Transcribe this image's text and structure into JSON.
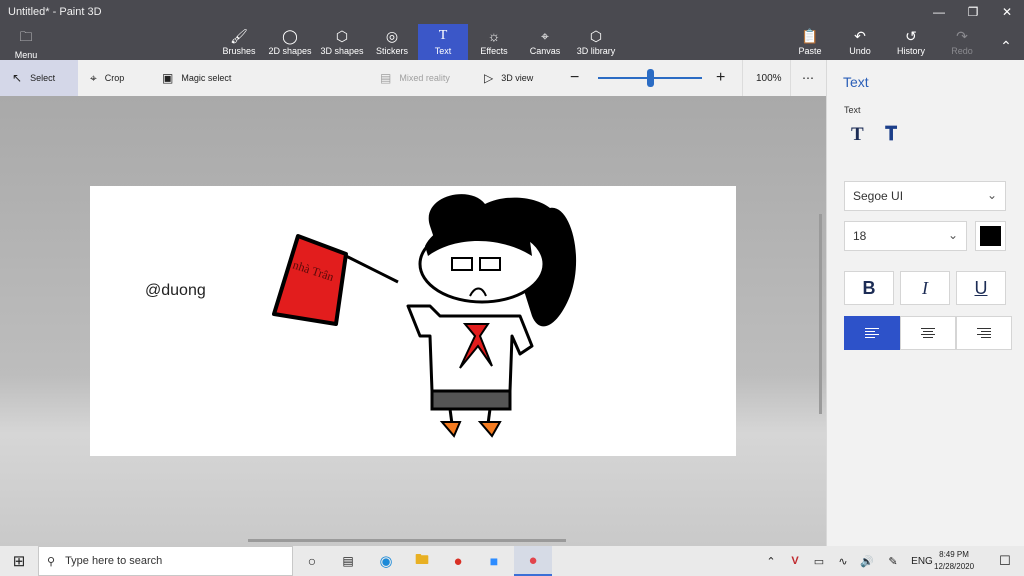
{
  "window": {
    "title": "Untitled* - Paint 3D"
  },
  "menu": {
    "label": "Menu"
  },
  "ribbon": {
    "brushes": "Brushes",
    "shapes2d": "2D shapes",
    "shapes3d": "3D shapes",
    "stickers": "Stickers",
    "text": "Text",
    "effects": "Effects",
    "canvas": "Canvas",
    "library": "3D library",
    "paste": "Paste",
    "undo": "Undo",
    "history": "History",
    "redo": "Redo"
  },
  "toolbar": {
    "select": "Select",
    "crop": "Crop",
    "magic_select": "Magic select",
    "mixed_reality": "Mixed reality",
    "view3d": "3D view",
    "zoom": "100%"
  },
  "zoom_level": 0.5,
  "canvas": {
    "text": "@duong",
    "flag_text": "nhà Trân"
  },
  "panel": {
    "title": "Text",
    "section": "Text",
    "font": "Segoe UI",
    "size": "18",
    "bold": "B",
    "italic": "I",
    "underline": "U",
    "color": "#000000"
  },
  "taskbar": {
    "search_placeholder": "Type here to search",
    "lang": "ENG",
    "time": "8:49 PM",
    "date": "12/28/2020"
  }
}
